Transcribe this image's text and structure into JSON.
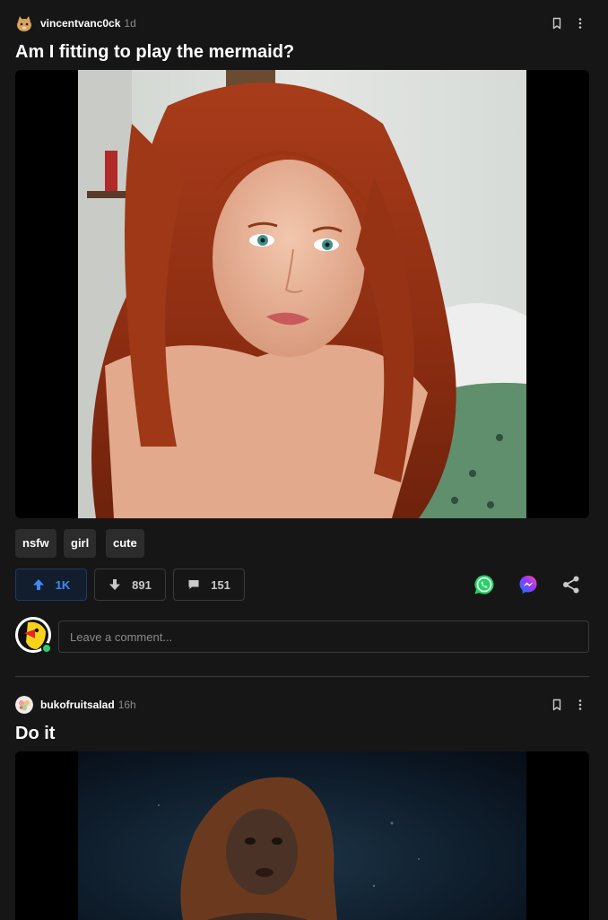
{
  "posts": [
    {
      "author": "vincentvanc0ck",
      "time": "1d",
      "title": "Am I fitting to play the mermaid?",
      "image_alt": "Red-haired woman lying on a bed with green floral sheets",
      "tags": [
        "nsfw",
        "girl",
        "cute"
      ],
      "upvotes": "1K",
      "downvotes": "891",
      "comments": "151"
    },
    {
      "author": "bukofruitsalad",
      "time": "16h",
      "title": "Do it",
      "image_alt": "Underwater scene of a girl with long hair"
    }
  ],
  "comment_box": {
    "placeholder": "Leave a comment..."
  },
  "colors": {
    "accent": "#3d8bf5",
    "whatsapp": "#25d366",
    "online": "#2ecc71"
  }
}
